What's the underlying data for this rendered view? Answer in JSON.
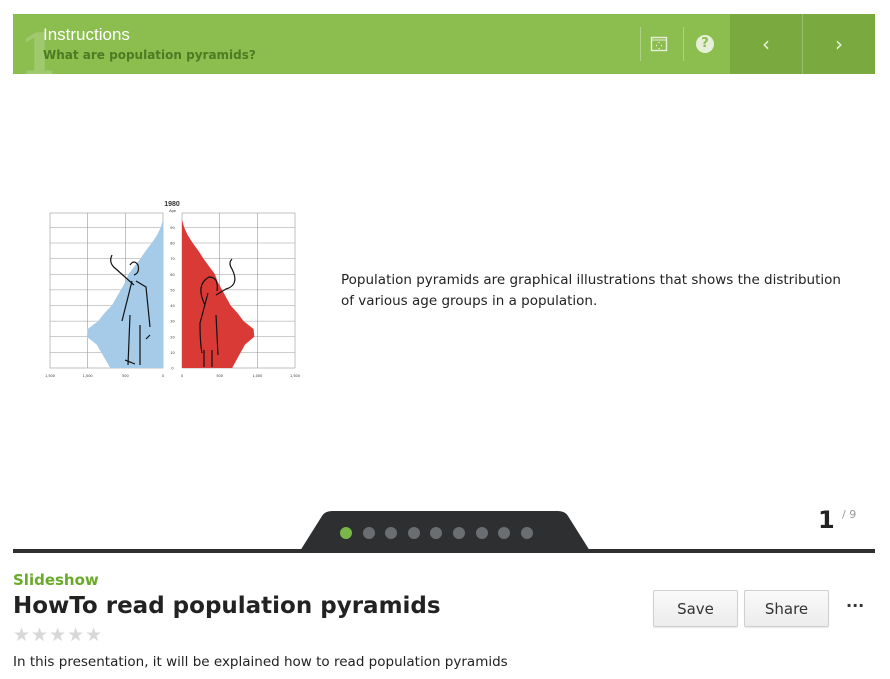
{
  "header": {
    "step_number": "1",
    "section": "Instructions",
    "subtitle": "What are population pyramids?",
    "icons": [
      "fullscreen-icon",
      "help-icon",
      "chevron-left-icon",
      "chevron-right-icon"
    ],
    "color": "#8bbd4f"
  },
  "slide": {
    "image": {
      "year": "1980",
      "age_label": "Age",
      "x_ticks_left": [
        "1,500",
        "1,000",
        "500",
        "0"
      ],
      "x_ticks_right": [
        "0",
        "500",
        "1,000",
        "1,500"
      ],
      "age_ticks": [
        "0",
        "10",
        "20",
        "30",
        "40",
        "50",
        "60",
        "70",
        "80",
        "90"
      ],
      "colors": {
        "male": "#a5cbe8",
        "female": "#d93a36"
      }
    },
    "text": "Population pyramids are graphical illustrations that shows the distribution of various age groups in a population."
  },
  "pager": {
    "current": "1",
    "total": "9",
    "total_label": "/ 9",
    "active_index": 0,
    "dot_count": 9,
    "active_color": "#7ab648"
  },
  "info": {
    "kind": "Slideshow",
    "title": "HowTo read population pyramids",
    "rating": 0,
    "max_rating": 5,
    "stars": "★★★★★",
    "description": "In this presentation, it will be explained how to read population pyramids"
  },
  "actions": {
    "save": "Save",
    "share": "Share",
    "more": "···"
  }
}
